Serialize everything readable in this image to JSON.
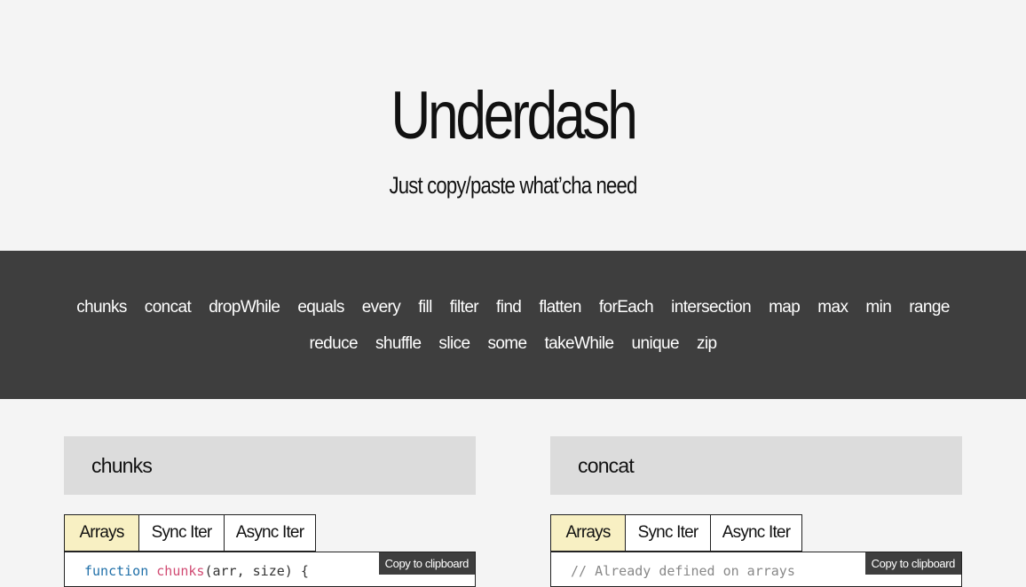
{
  "header": {
    "title": "Underdash",
    "subtitle": "Just copy/paste what’cha need"
  },
  "nav": [
    "chunks",
    "concat",
    "dropWhile",
    "equals",
    "every",
    "fill",
    "filter",
    "find",
    "flatten",
    "forEach",
    "intersection",
    "map",
    "max",
    "min",
    "range",
    "reduce",
    "shuffle",
    "slice",
    "some",
    "takeWhile",
    "unique",
    "zip"
  ],
  "cards": [
    {
      "title": "chunks",
      "tabs": [
        "Arrays",
        "Sync Iter",
        "Async Iter"
      ],
      "active_tab": "Arrays",
      "copy_label": "Copy to clipboard",
      "code": {
        "kw": "function",
        "fn": "chunks",
        "rest": "(arr, size) {"
      }
    },
    {
      "title": "concat",
      "tabs": [
        "Arrays",
        "Sync Iter",
        "Async Iter"
      ],
      "active_tab": "Arrays",
      "copy_label": "Copy to clipboard",
      "code": {
        "comment": "// Already defined on arrays"
      }
    }
  ]
}
